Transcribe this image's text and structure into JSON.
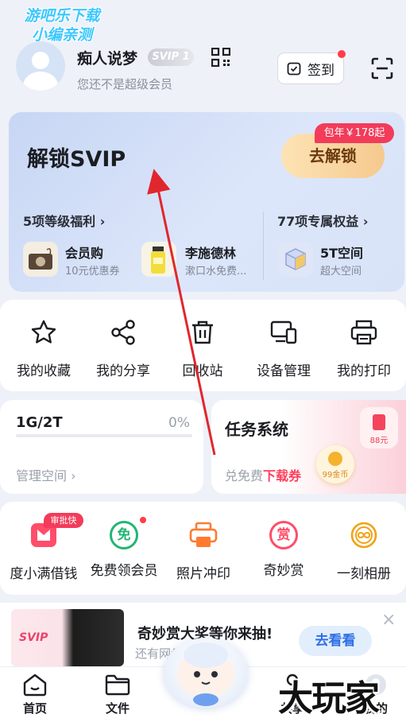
{
  "watermark_top": [
    "游吧乐下载",
    "小编亲测"
  ],
  "watermark_bottom": "大玩家",
  "header": {
    "username": "痴人说梦",
    "svip_badge": "SVIP 1",
    "member_status": "您还不是超级会员",
    "signin_label": "签到",
    "icons": [
      "avatar",
      "qr-code-icon",
      "calendar-check-icon",
      "scan-icon"
    ]
  },
  "svip_card": {
    "title": "解锁SVIP",
    "price_tag": "包年￥178起",
    "unlock_label": "去解锁",
    "levels_link": "5项等级福利",
    "rights_link": "77项专属权益",
    "perks": [
      {
        "title": "会员购",
        "sub": "10元优惠券",
        "icon": "camera-product-icon"
      },
      {
        "title": "李施德林",
        "sub": "漱口水免费...",
        "icon": "mouthwash-product-icon"
      },
      {
        "title": "5T空间",
        "sub": "超大空间",
        "icon": "cube-storage-icon"
      }
    ]
  },
  "tools": [
    {
      "label": "我的收藏",
      "icon": "star-icon"
    },
    {
      "label": "我的分享",
      "icon": "share-icon"
    },
    {
      "label": "回收站",
      "icon": "trash-icon"
    },
    {
      "label": "设备管理",
      "icon": "devices-icon"
    },
    {
      "label": "我的打印",
      "icon": "printer-icon"
    }
  ],
  "storage": {
    "used_total": "1G/2T",
    "percent_label": "0%",
    "percent_value": 0,
    "manage_label": "管理空间"
  },
  "task": {
    "title": "任务系统",
    "sub_prefix": "兑免费",
    "sub_highlight": "下载券",
    "coin_label": "99金币",
    "redpacket_label": "88元"
  },
  "services": [
    {
      "label": "度小满借钱",
      "icon": "wallet-icon",
      "tag": "审批快"
    },
    {
      "label": "免费领会员",
      "icon": "free-badge-icon",
      "glyph": "免"
    },
    {
      "label": "照片冲印",
      "icon": "photo-print-icon"
    },
    {
      "label": "奇妙赏",
      "icon": "reward-badge-icon",
      "glyph": "赏"
    },
    {
      "label": "一刻相册",
      "icon": "album-infinity-icon"
    }
  ],
  "banner": {
    "title": "奇妙赏大奖等你来抽!",
    "sub": "还有网盘...至底",
    "button": "去看看",
    "close": "×",
    "img_text": "SVIP"
  },
  "nav": [
    {
      "label": "首页",
      "icon": "home-icon"
    },
    {
      "label": "文件",
      "icon": "folder-icon"
    },
    {
      "label": "",
      "icon": "mascot-icon"
    },
    {
      "label": "共享",
      "icon": "share-people-icon"
    },
    {
      "label": "我的",
      "icon": "profile-icon"
    }
  ],
  "colors": {
    "accent_red": "#f23c5a",
    "brand_blue": "#2e6fe8",
    "annotation_arrow": "#e0272d",
    "background": "#eef1f8"
  }
}
